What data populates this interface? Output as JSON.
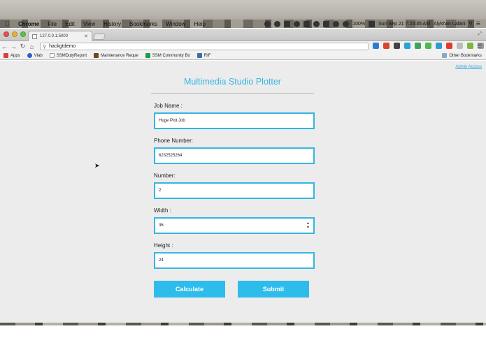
{
  "menubar": {
    "app": "Chrome",
    "items": [
      "File",
      "Edit",
      "View",
      "History",
      "Bookmarks",
      "Window",
      "Help"
    ],
    "battery": "100%",
    "datetime": "Sun Sep 21  7:23:35 AM",
    "user": "Alykhan Lalani"
  },
  "browser": {
    "tab_title": "127.0.0.1:5000",
    "address": "hackgtdemo",
    "bookmarks": [
      "Apps",
      "Vlab",
      "SSMDutyReport",
      "Maintenance Reque",
      "SSM Community Bo",
      "RIF"
    ],
    "other_bookmarks": "Other Bookmarks"
  },
  "page": {
    "admin_link": "Admin Access",
    "title": "Multimedia Studio Plotter",
    "fields": {
      "job_name": {
        "label": "Job Name :",
        "value": "Huge Plot Job"
      },
      "phone": {
        "label": "Phone Number:",
        "value": "6232525264"
      },
      "number": {
        "label": "Number:",
        "value": "2"
      },
      "width": {
        "label": "Width :",
        "value": "36"
      },
      "height": {
        "label": "Height :",
        "value": "24"
      }
    },
    "buttons": {
      "calculate": "Calculate",
      "submit": "Submit"
    }
  },
  "colors": {
    "accent": "#35b6e2",
    "button": "#2ebcec",
    "page_bg": "#ececec"
  }
}
